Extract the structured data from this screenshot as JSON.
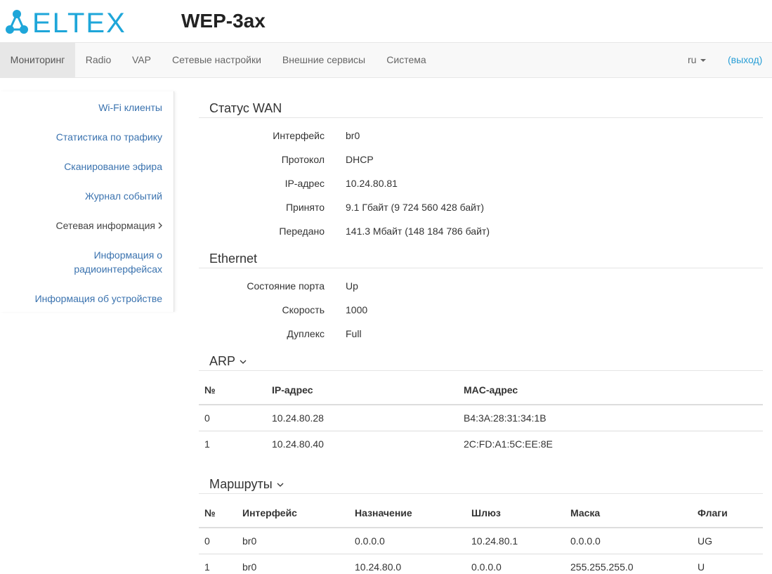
{
  "header": {
    "logo_text": "ELTEX",
    "product": "WEP-3ax",
    "brand_color": "#1ea6d9"
  },
  "nav": {
    "items": [
      {
        "label": "Мониторинг",
        "active": true
      },
      {
        "label": "Radio"
      },
      {
        "label": "VAP"
      },
      {
        "label": "Сетевые настройки"
      },
      {
        "label": "Внешние сервисы"
      },
      {
        "label": "Система"
      }
    ],
    "lang": "ru",
    "logout": "(выход)"
  },
  "sidebar": {
    "items": [
      {
        "label": "Wi-Fi клиенты"
      },
      {
        "label": "Статистика по трафику"
      },
      {
        "label": "Сканирование эфира"
      },
      {
        "label": "Журнал событий"
      },
      {
        "label": "Сетевая информация",
        "current": true
      },
      {
        "label": "Информация о радиоинтерфейсах"
      },
      {
        "label": "Информация об устройстве"
      }
    ]
  },
  "wan": {
    "title": "Статус WAN",
    "rows": [
      {
        "label": "Интерфейс",
        "value": "br0"
      },
      {
        "label": "Протокол",
        "value": "DHCP"
      },
      {
        "label": "IP-адрес",
        "value": "10.24.80.81"
      },
      {
        "label": "Принято",
        "value": "9.1 Гбайт (9 724 560 428 байт)"
      },
      {
        "label": "Передано",
        "value": "141.3 Мбайт (148 184 786 байт)"
      }
    ]
  },
  "ethernet": {
    "title": "Ethernet",
    "rows": [
      {
        "label": "Состояние порта",
        "value": "Up"
      },
      {
        "label": "Скорость",
        "value": "1000"
      },
      {
        "label": "Дуплекс",
        "value": "Full"
      }
    ]
  },
  "arp": {
    "title": "ARP",
    "columns": [
      "№",
      "IP-адрес",
      "MAC-адрес"
    ],
    "rows": [
      [
        "0",
        "10.24.80.28",
        "B4:3A:28:31:34:1B"
      ],
      [
        "1",
        "10.24.80.40",
        "2C:FD:A1:5C:EE:8E"
      ]
    ]
  },
  "routes": {
    "title": "Маршруты",
    "columns": [
      "№",
      "Интерфейс",
      "Назначение",
      "Шлюз",
      "Маска",
      "Флаги"
    ],
    "rows": [
      [
        "0",
        "br0",
        "0.0.0.0",
        "10.24.80.1",
        "0.0.0.0",
        "UG"
      ],
      [
        "1",
        "br0",
        "10.24.80.0",
        "0.0.0.0",
        "255.255.255.0",
        "U"
      ]
    ]
  }
}
